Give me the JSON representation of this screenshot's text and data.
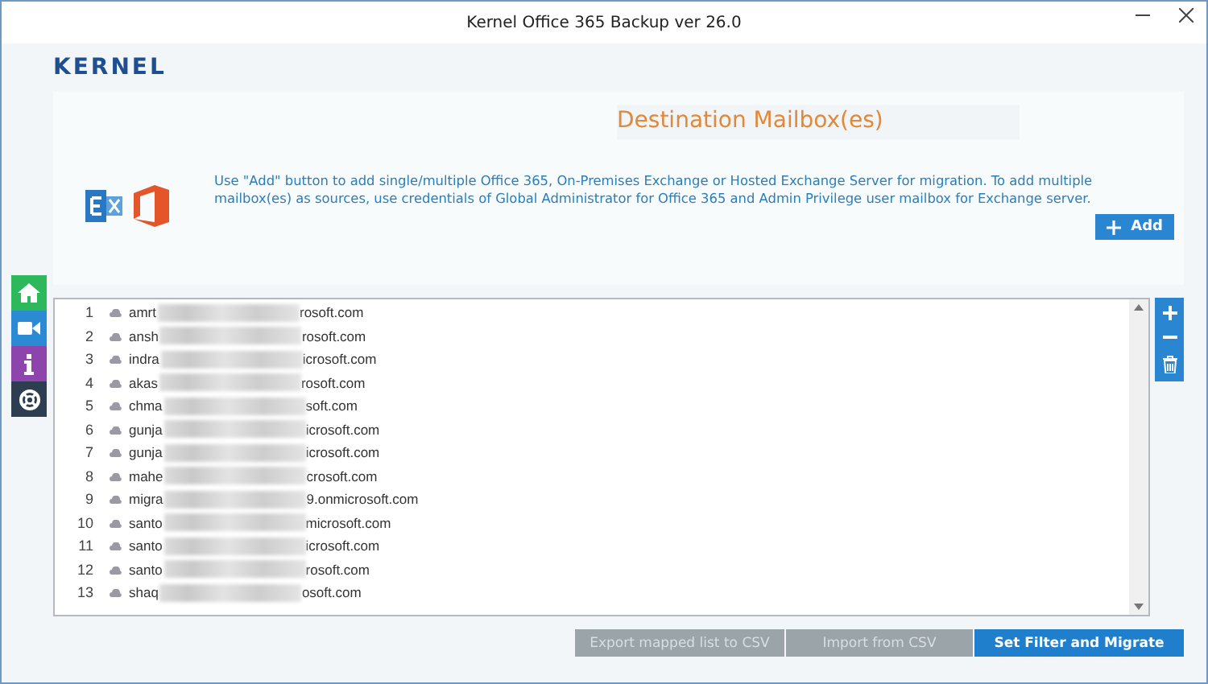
{
  "window": {
    "title": "Kernel Office 365 Backup ver 26.0"
  },
  "logo": "KERNEL",
  "panel": {
    "heading": "Destination Mailbox(es)",
    "description": "Use \"Add\" button to add single/multiple Office 365, On-Premises Exchange or Hosted Exchange Server for migration. To add multiple mailbox(es) as sources, use credentials of Global Administrator for Office 365 and Admin Privilege user mailbox for Exchange server.",
    "add_button": "Add"
  },
  "sidebar": [
    {
      "kind": "home",
      "color": "#2eb85c"
    },
    {
      "kind": "video",
      "color": "#2a8ad4"
    },
    {
      "kind": "info",
      "color": "#8e44ad"
    },
    {
      "kind": "help",
      "color": "#2c3e50"
    }
  ],
  "mailboxes": [
    {
      "number": "1",
      "prefix": "amrt",
      "suffix": "rosoft.com"
    },
    {
      "number": "2",
      "prefix": "ansh",
      "suffix": "rosoft.com"
    },
    {
      "number": "3",
      "prefix": "indra",
      "suffix": "icrosoft.com"
    },
    {
      "number": "4",
      "prefix": "akas",
      "suffix": "rosoft.com"
    },
    {
      "number": "5",
      "prefix": "chma",
      "suffix": "soft.com"
    },
    {
      "number": "6",
      "prefix": "gunja",
      "suffix": "icrosoft.com"
    },
    {
      "number": "7",
      "prefix": "gunja",
      "suffix": "icrosoft.com"
    },
    {
      "number": "8",
      "prefix": "mahe",
      "suffix": "crosoft.com"
    },
    {
      "number": "9",
      "prefix": "migra",
      "suffix": "9.onmicrosoft.com"
    },
    {
      "number": "10",
      "prefix": "santo",
      "suffix": "microsoft.com"
    },
    {
      "number": "11",
      "prefix": "santo",
      "suffix": "icrosoft.com"
    },
    {
      "number": "12",
      "prefix": "santo",
      "suffix": "rosoft.com"
    },
    {
      "number": "13",
      "prefix": "shaq",
      "suffix": "osoft.com"
    }
  ],
  "footer_buttons": [
    {
      "label": "Export mapped list to CSV",
      "disabled": true
    },
    {
      "label": "Import from CSV",
      "disabled": true
    },
    {
      "label": "Set Filter and Migrate",
      "disabled": false
    }
  ]
}
